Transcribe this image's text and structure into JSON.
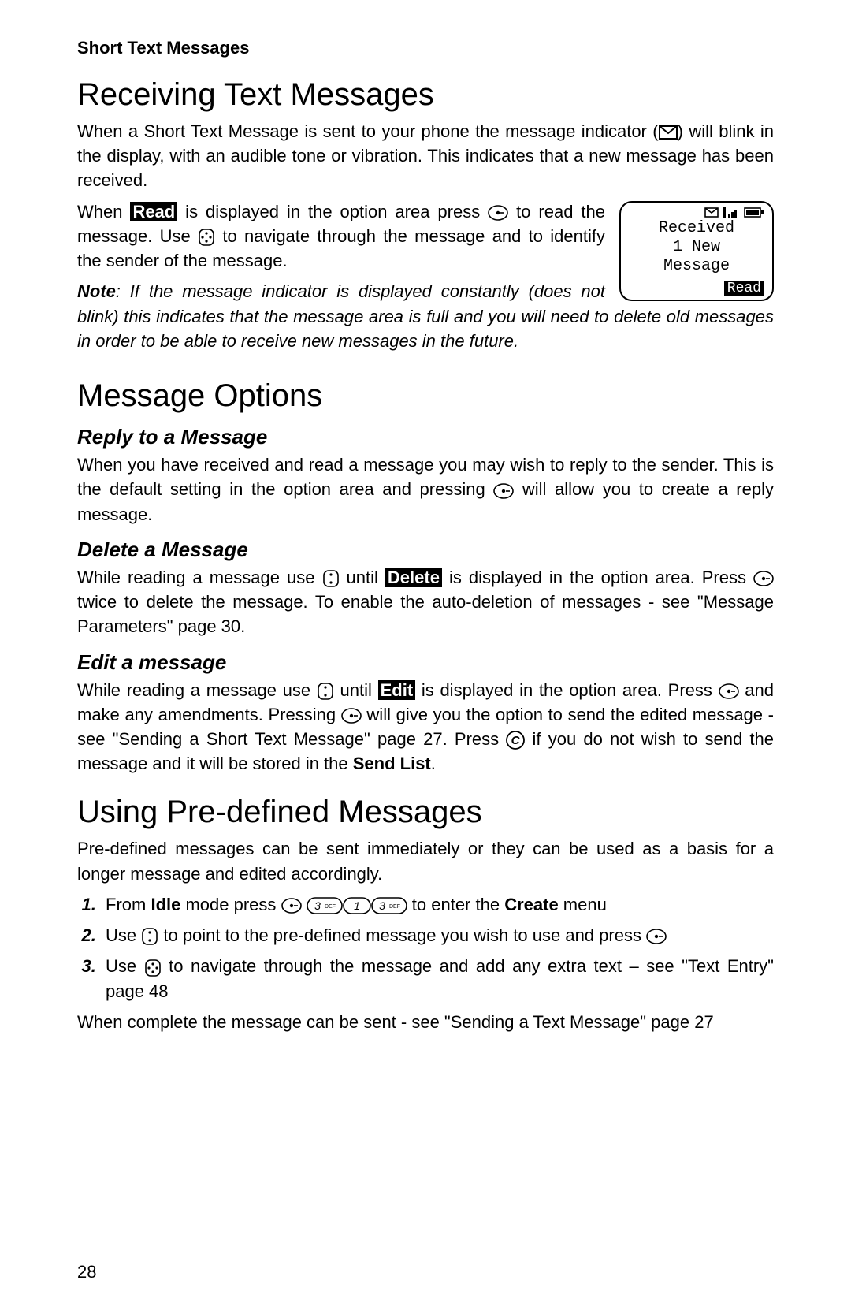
{
  "header": "Short Text Messages",
  "page_number": "28",
  "section1": {
    "title": "Receiving Text Messages",
    "para1a": "When a Short Text Message is sent to your phone the message indicator (",
    "para1b": ") will blink in the display, with an audible tone or vibration. This indicates that a new message has been received.",
    "para2a": "When ",
    "read_inv": "Read",
    "para2b": " is displayed in the option area press ",
    "para2c": " to read the message. Use ",
    "para2d": " to navigate through the message and to identify the sender of the message.",
    "note_label": "Note",
    "note_text": ": If the message indicator is displayed constantly (does not blink) this indicates that the message area is full and you will need to delete old messages in order to be able to receive new messages in the future."
  },
  "phone": {
    "line1": "Received",
    "line2": "1 New",
    "line3": "Message",
    "softkey": "Read"
  },
  "section2": {
    "title": "Message Options",
    "sub1": {
      "title": "Reply to a Message",
      "text_a": "When you have received and read a message you may wish to reply to the sender. This is the default setting in the option area and pressing ",
      "text_b": " will allow you to create a reply message."
    },
    "sub2": {
      "title": "Delete a Message",
      "text_a": "While reading a message use ",
      "text_b": " until ",
      "delete_inv": "Delete",
      "text_c": " is displayed in the option area. Press ",
      "text_d": " twice to delete the message. To enable the auto-deletion of messages - see \"Message Parameters\" page 30."
    },
    "sub3": {
      "title": "Edit a message",
      "text_a": "While reading a message use ",
      "text_b": " until ",
      "edit_inv": "Edit",
      "text_c": " is displayed in the option area. Press ",
      "text_d": " and make any amendments. Pressing ",
      "text_e": " will give you the option to send the edited message - see \"Sending a Short Text Message\" page 27. Press ",
      "text_f": " if you do not wish to send the message and it will be stored in the ",
      "send_list": "Send List",
      "text_g": "."
    }
  },
  "section3": {
    "title": "Using Pre-defined Messages",
    "intro": "Pre-defined messages can be sent immediately or they can be used as a basis for a longer message and edited accordingly.",
    "step1_a": "From ",
    "step1_idle": "Idle",
    "step1_b": " mode press ",
    "step1_c": " to enter the ",
    "step1_create": "Create",
    "step1_d": " menu",
    "step2_a": "Use ",
    "step2_b": " to point to the pre-defined message you wish to use and press ",
    "step3_a": "Use ",
    "step3_b": " to navigate through the message and add any extra text – see \"Text Entry\" page 48",
    "outro": "When complete the message can be sent - see \"Sending a Text Message\" page 27"
  },
  "keys": {
    "three": "3",
    "three_sub": "DEF",
    "one": "1"
  }
}
